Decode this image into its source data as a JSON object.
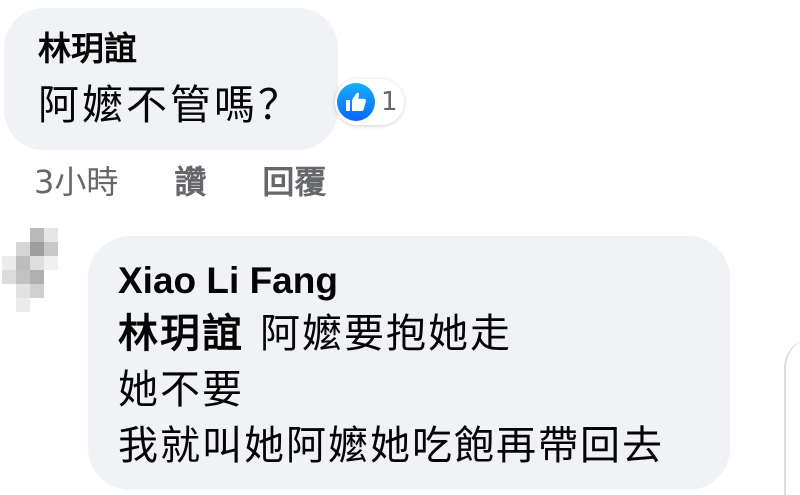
{
  "comment": {
    "author": "林玥誼",
    "text": "阿嬤不管嗎？",
    "reaction": {
      "icon": "thumbs-up-icon",
      "count": "1",
      "color": "#0866ff"
    },
    "time": "3小時",
    "like_label": "讚",
    "reply_label": "回覆"
  },
  "reply": {
    "author": "Xiao Li Fang",
    "mention": "林玥誼",
    "first_line": "阿嬤要抱她走",
    "line2": "她不要",
    "line3": "我就叫她阿嬤她吃飽再帶回去"
  },
  "colors": {
    "bubble": "#f0f2f5",
    "meta_text": "#65676b",
    "body_text": "#050505"
  }
}
